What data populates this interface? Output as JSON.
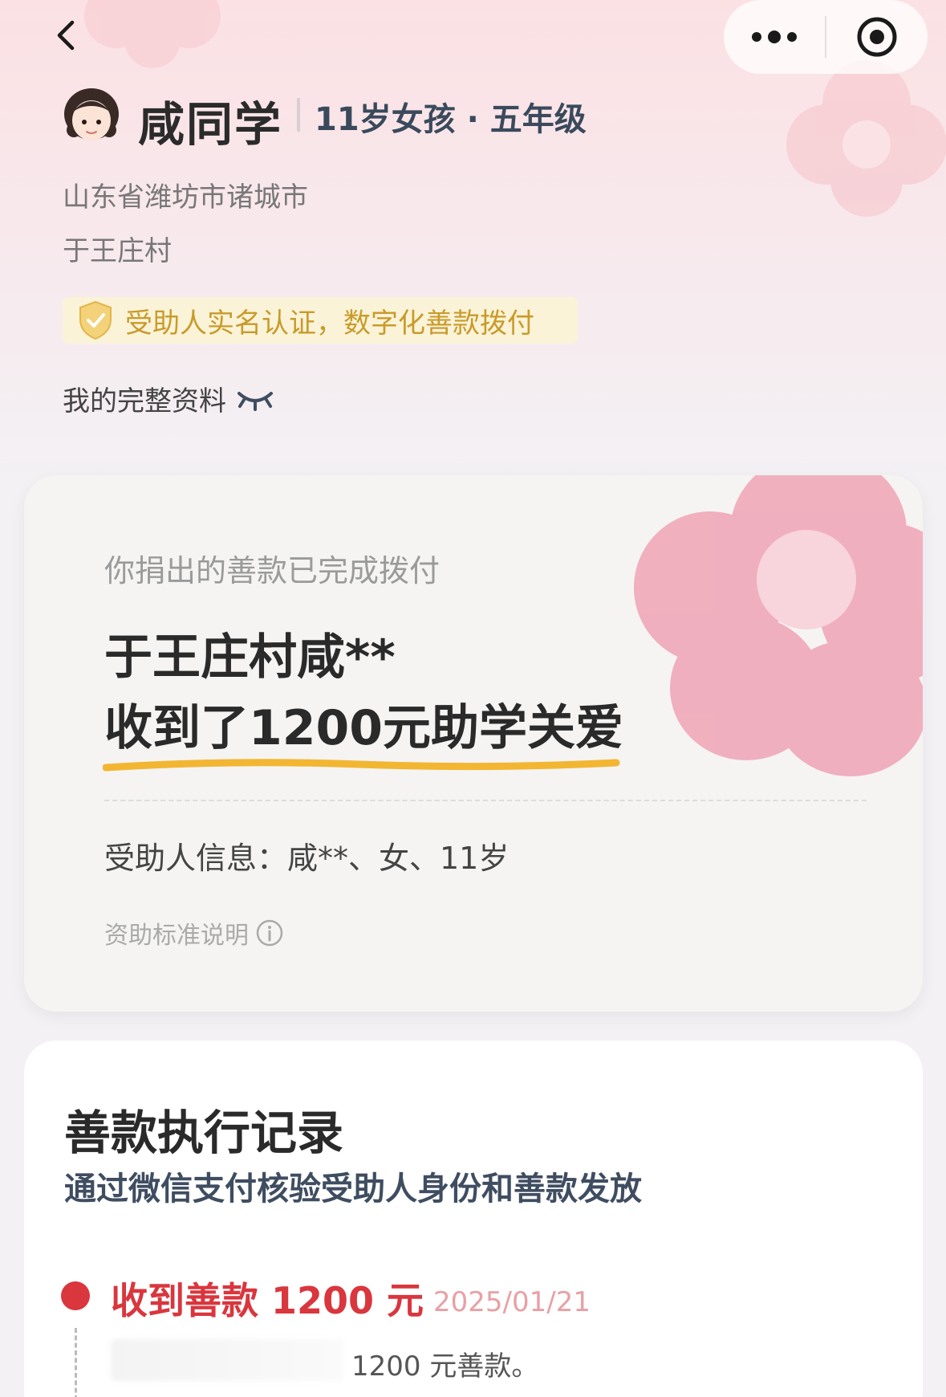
{
  "header": {
    "name": "咸同学",
    "meta": "11岁女孩 · 五年级",
    "address_line1": "山东省潍坊市诸城市",
    "address_line2": "于王庄村",
    "verify_text": "受助人实名认证，数字化善款拨付",
    "profile_link": "我的完整资料"
  },
  "donation_card": {
    "subtitle": "你捐出的善款已完成拨付",
    "line1": "于王庄村咸**",
    "line2": "收到了1200元助学关爱",
    "recipient_info": "受助人信息：咸**、女、11岁",
    "standard_link": "资助标准说明"
  },
  "records": {
    "title": "善款执行记录",
    "subtitle": "通过微信支付核验受助人身份和善款发放",
    "items": [
      {
        "title": "收到善款 1200 元",
        "date": "2025/01/21",
        "desc": "1200 元善款。"
      }
    ]
  },
  "colors": {
    "accent_red": "#d9363e",
    "verify_gold": "#c89b2a",
    "flower_pink": "#f0a3b5"
  },
  "icons": [
    "back-icon",
    "more-icon",
    "close-target-icon",
    "avatar-girl-icon",
    "shield-check-icon",
    "eye-closed-icon",
    "info-icon"
  ]
}
